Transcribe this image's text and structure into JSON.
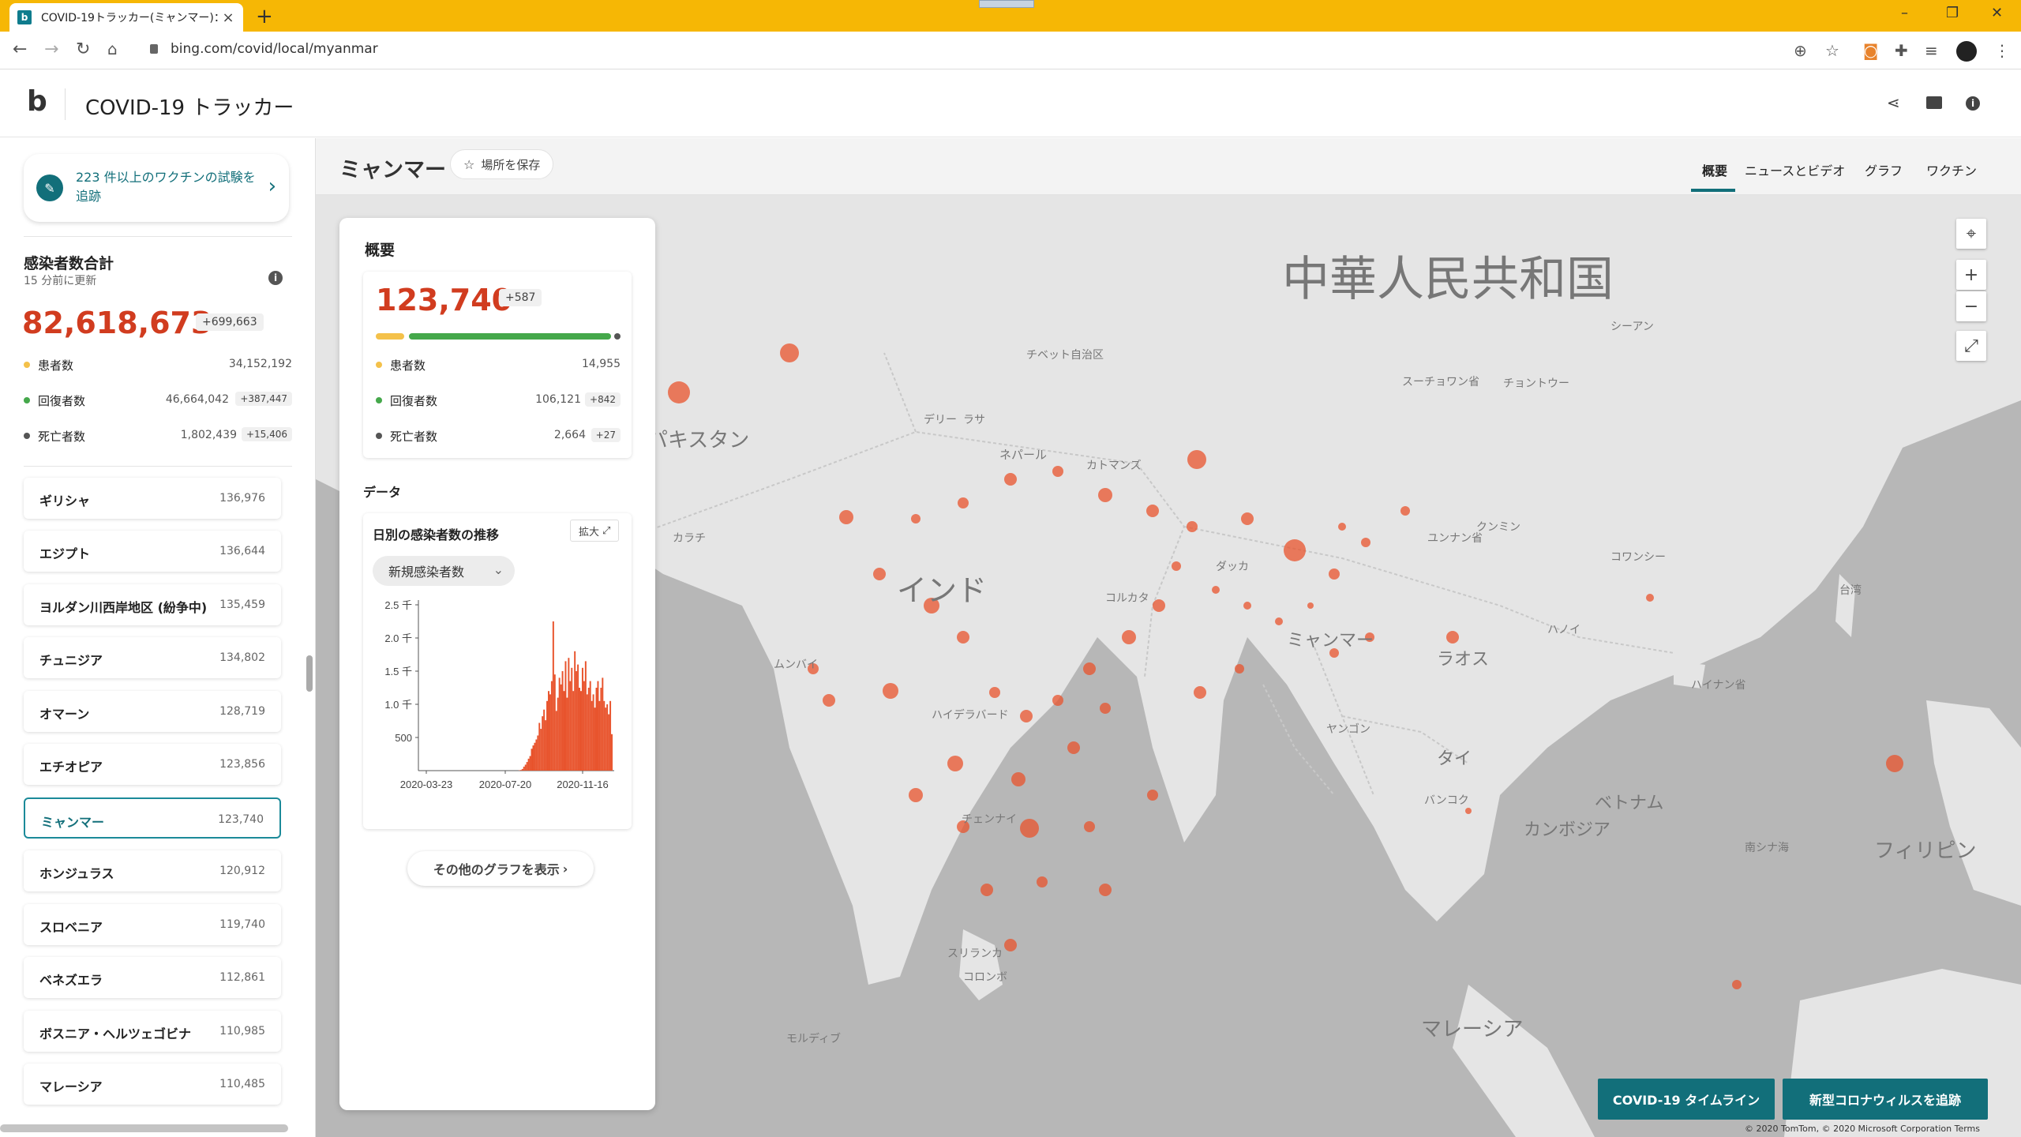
{
  "browser": {
    "tab_title": "COVID-19トラッカー(ミャンマー)：新...",
    "favicon": "b",
    "url": "bing.com/covid/local/myanmar"
  },
  "app": {
    "logo": "b",
    "title": "COVID-19 トラッカー"
  },
  "sidebar": {
    "vaccine_banner": "223 件以上のワクチンの試験を追跡",
    "total_label": "感染者数合計",
    "updated": "15 分前に更新",
    "total_value": "82,618,673",
    "total_delta": "+699,663",
    "stats": [
      {
        "label": "患者数",
        "value": "34,152,192",
        "delta": "",
        "color": "#f4c14a"
      },
      {
        "label": "回復者数",
        "value": "46,664,042",
        "delta": "+387,447",
        "color": "#45a84b"
      },
      {
        "label": "死亡者数",
        "value": "1,802,439",
        "delta": "+15,406",
        "color": "#555555"
      }
    ],
    "countries": [
      {
        "name": "ギリシャ",
        "value": "136,976"
      },
      {
        "name": "エジプト",
        "value": "136,644"
      },
      {
        "name": "ヨルダン川西岸地区 (紛争中)",
        "value": "135,459"
      },
      {
        "name": "チュニジア",
        "value": "134,802"
      },
      {
        "name": "オマーン",
        "value": "128,719"
      },
      {
        "name": "エチオピア",
        "value": "123,856"
      },
      {
        "name": "ミャンマー",
        "value": "123,740"
      },
      {
        "name": "ホンジュラス",
        "value": "120,912"
      },
      {
        "name": "スロベニア",
        "value": "119,740"
      },
      {
        "name": "ベネズエラ",
        "value": "112,861"
      },
      {
        "name": "ボスニア・ヘルツェゴビナ",
        "value": "110,985"
      },
      {
        "name": "マレーシア",
        "value": "110,485"
      }
    ]
  },
  "location": {
    "name": "ミャンマー",
    "save_label": "場所を保存",
    "tabs": [
      "概要",
      "ニュースとビデオ",
      "グラフ",
      "ワクチン"
    ]
  },
  "overview": {
    "title": "概要",
    "total": "123,740",
    "delta": "+587",
    "stats": [
      {
        "label": "患者数",
        "value": "14,955",
        "delta": "",
        "color": "#f4c14a"
      },
      {
        "label": "回復者数",
        "value": "106,121",
        "delta": "+842",
        "color": "#45a84b"
      },
      {
        "label": "死亡者数",
        "value": "2,664",
        "delta": "+27",
        "color": "#555555"
      }
    ],
    "data_title": "データ",
    "chart_title": "日別の感染者数の推移",
    "expand_label": "拡大",
    "dropdown_value": "新規感染者数",
    "more_graphs": "その他のグラフを表示"
  },
  "chart_data": {
    "type": "bar",
    "title": "日別の感染者数の推移",
    "series_label": "新規感染者数",
    "x_ticks": [
      "2020-03-23",
      "2020-07-20",
      "2020-11-16"
    ],
    "y_ticks": [
      "500",
      "1.0 千",
      "1.5 千",
      "2.0 千",
      "2.5 千"
    ],
    "ylim": [
      0,
      2500
    ],
    "color": "#e8532c",
    "values": [
      0,
      0,
      0,
      0,
      0,
      0,
      0,
      0,
      0,
      0,
      0,
      0,
      0,
      0,
      0,
      0,
      0,
      0,
      0,
      0,
      0,
      0,
      0,
      0,
      0,
      0,
      0,
      0,
      0,
      0,
      0,
      0,
      0,
      0,
      0,
      0,
      0,
      0,
      0,
      0,
      0,
      0,
      0,
      0,
      0,
      0,
      0,
      0,
      0,
      0,
      0,
      0,
      0,
      0,
      0,
      0,
      0,
      0,
      0,
      0,
      0,
      0,
      0,
      0,
      5,
      10,
      25,
      60,
      90,
      130,
      180,
      220,
      330,
      380,
      420,
      470,
      530,
      720,
      630,
      820,
      920,
      760,
      1050,
      1200,
      1150,
      1350,
      2250,
      1450,
      900,
      1100,
      1400,
      1300,
      1500,
      1200,
      1650,
      1100,
      1700,
      1350,
      1550,
      1200,
      1800,
      1500,
      1600,
      1250,
      1200,
      1550,
      1350,
      1650,
      1150,
      1250,
      1350,
      1050,
      1150,
      950,
      1250,
      1350,
      1050,
      1250,
      1400,
      1050,
      950,
      1000,
      850,
      1050,
      550
    ]
  },
  "map": {
    "labels": {
      "china": "中華人民共和国",
      "india": "インド",
      "pakistan": "パキスタン",
      "myanmar": "ミャンマー",
      "laos": "ラオス",
      "thailand": "タイ",
      "vietnam": "ベトナム",
      "cambodia": "カンボジア",
      "malaysia": "マレーシア",
      "philippines": "フィリピン",
      "nepal": "ネパール",
      "tibet": "チベット自治区",
      "lhasa": "ラサ",
      "delhi": "デリー",
      "mumbai": "ムンバイ",
      "hyderabad": "ハイデラバード",
      "chennai": "チェンナイ",
      "bangkok": "バンコク",
      "hanoi": "ハノイ",
      "karachi": "カラチ",
      "srilanka": "スリランカ",
      "colombo": "コロンボ",
      "yunnan": "ユンナン省",
      "sichuan": "スーチョワン省",
      "guangxi": "コワンシー",
      "hainan": "ハイナン省",
      "yangon": "ヤンゴン",
      "taiwan": "台湾",
      "kathmandu": "カトマンズ",
      "dhaka": "ダッカ",
      "kolkata": "コルカタ",
      "chongqing": "チョントウー",
      "xian": "シーアン",
      "kunming": "クンミン",
      "scs": "南シナ海",
      "maldives": "モルディブ"
    },
    "controls": [
      "locate-icon",
      "zoom-in-icon",
      "zoom-out-icon",
      "expand-icon"
    ],
    "button_timeline": "COVID-19 タイムライン",
    "button_track": "新型コロナウィルスを追跡",
    "copyright": "© 2020 TomTom, © 2020 Microsoft Corporation Terms"
  }
}
